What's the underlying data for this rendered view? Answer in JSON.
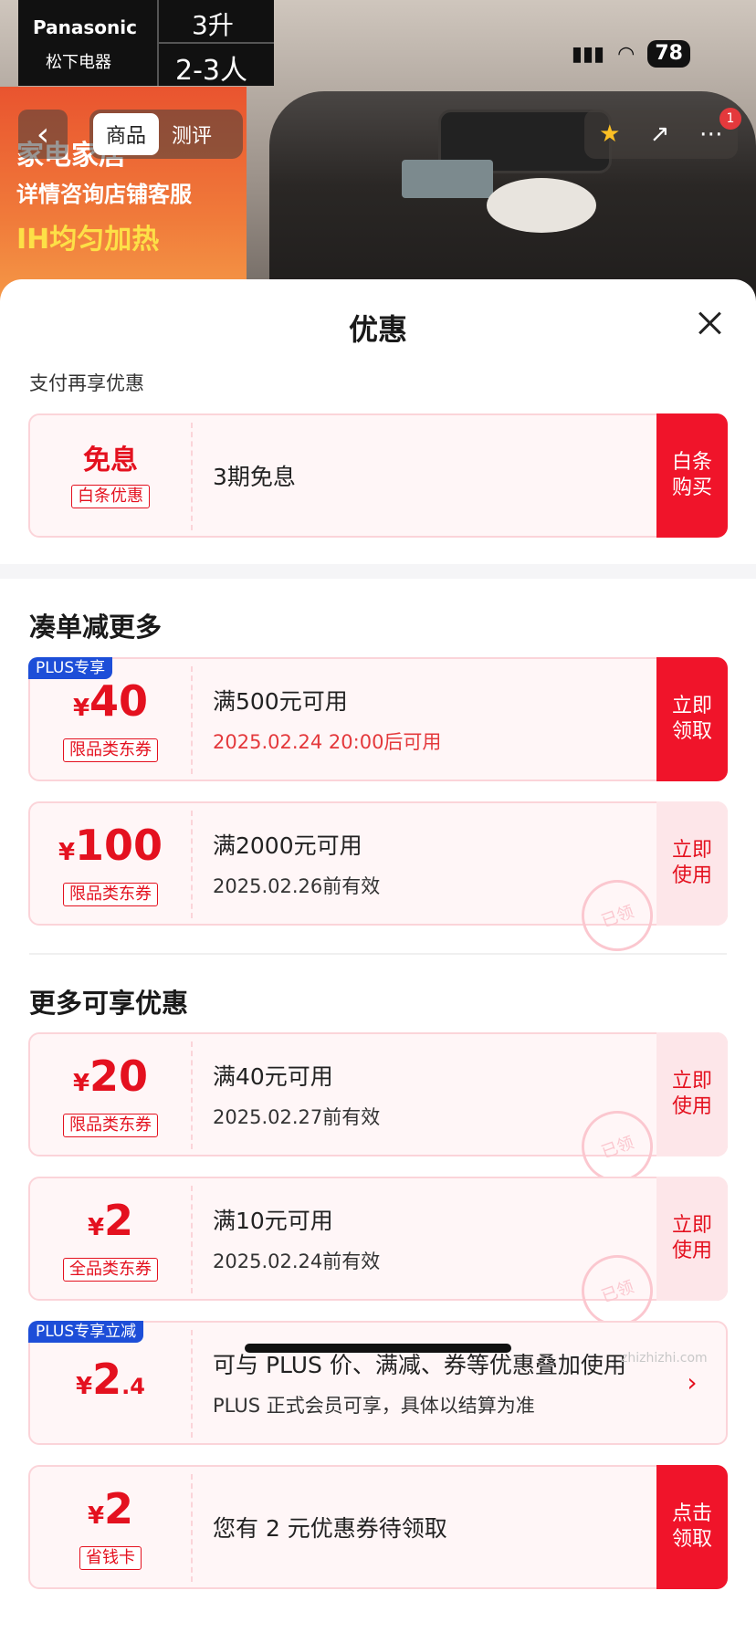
{
  "hero": {
    "brand_en": "Panasonic",
    "brand_cn": "松下电器",
    "spec_capacity": "3升",
    "spec_people": "2-3人",
    "promo_line1": "家电家居",
    "promo_line2": "详情咨询店铺客服",
    "promo_line3": "IH均匀加热"
  },
  "status": {
    "battery": "78"
  },
  "nav": {
    "back": "‹",
    "tabs": [
      "商品",
      "测评"
    ],
    "cart_badge": "1"
  },
  "sheet": {
    "title": "优惠",
    "subtitle": "支付再享优惠",
    "baitiao": {
      "amount": "免息",
      "tag": "白条优惠",
      "line1": "3期免息",
      "action": [
        "白条",
        "购买"
      ]
    },
    "section1": "凑单减更多",
    "section2": "更多可享优惠",
    "coupons": [
      {
        "badge": "PLUS专享",
        "yen": "¥",
        "amount": "40",
        "tag": "限品类东券",
        "line1": "满500元可用",
        "line2": "2025.02.24 20:00后可用",
        "action": [
          "立即",
          "领取"
        ]
      },
      {
        "yen": "¥",
        "amount": "100",
        "tag": "限品类东券",
        "line1": "满2000元可用",
        "line2": "2025.02.26前有效",
        "action": [
          "立即",
          "使用"
        ],
        "stamp": "已领"
      },
      {
        "yen": "¥",
        "amount": "20",
        "tag": "限品类东券",
        "line1": "满40元可用",
        "line2": "2025.02.27前有效",
        "action": [
          "立即",
          "使用"
        ],
        "stamp": "已领"
      },
      {
        "yen": "¥",
        "amount": "2",
        "tag": "全品类东券",
        "line1": "满10元可用",
        "line2": "2025.02.24前有效",
        "action": [
          "立即",
          "使用"
        ],
        "stamp": "已领"
      },
      {
        "badge": "PLUS专享立减",
        "yen": "¥",
        "amount": "2",
        "decimal": ".4",
        "line1": "可与 PLUS 价、满减、券等优惠叠加使用",
        "line2": "PLUS 正式会员可享，具体以结算为准",
        "action": "›"
      },
      {
        "yen": "¥",
        "amount": "2",
        "tag": "省钱卡",
        "line1": "您有 2 元优惠券待领取",
        "action": [
          "点击",
          "领取"
        ]
      }
    ]
  },
  "watermark": "zhizhizhi.com",
  "colors": {
    "accent": "#f0142a",
    "plus": "#1d4ed8",
    "card_bg": "#fff6f7"
  }
}
